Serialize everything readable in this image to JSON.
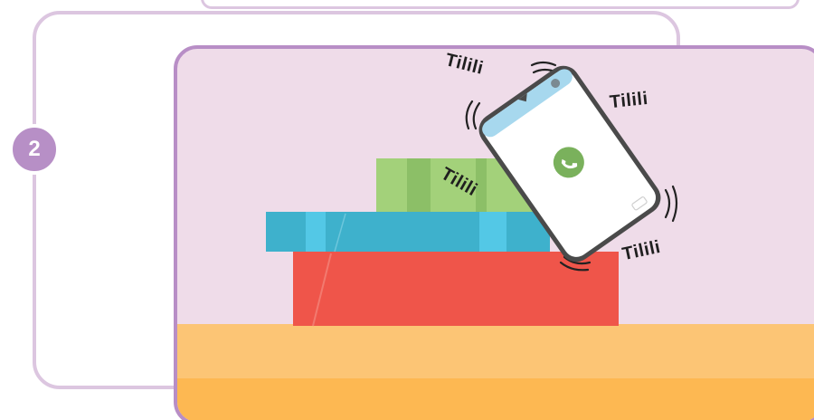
{
  "step": {
    "number": "2"
  },
  "scene": {
    "sounds": [
      "Tilili",
      "Tilili",
      "Tilili",
      "Tilili"
    ],
    "phone_state": "ringing",
    "phone_icon": "phone-call-icon"
  },
  "colors": {
    "scene_bg": "#efdce9",
    "panel_border": "#b88ec6",
    "badge": "#b78fc6",
    "table_top": "#fcc575",
    "table_front": "#fdb852",
    "book_green": "#a3d17a",
    "book_blue": "#3eb1cc",
    "book_red": "#ef554a",
    "call_button": "#7ab15c"
  }
}
